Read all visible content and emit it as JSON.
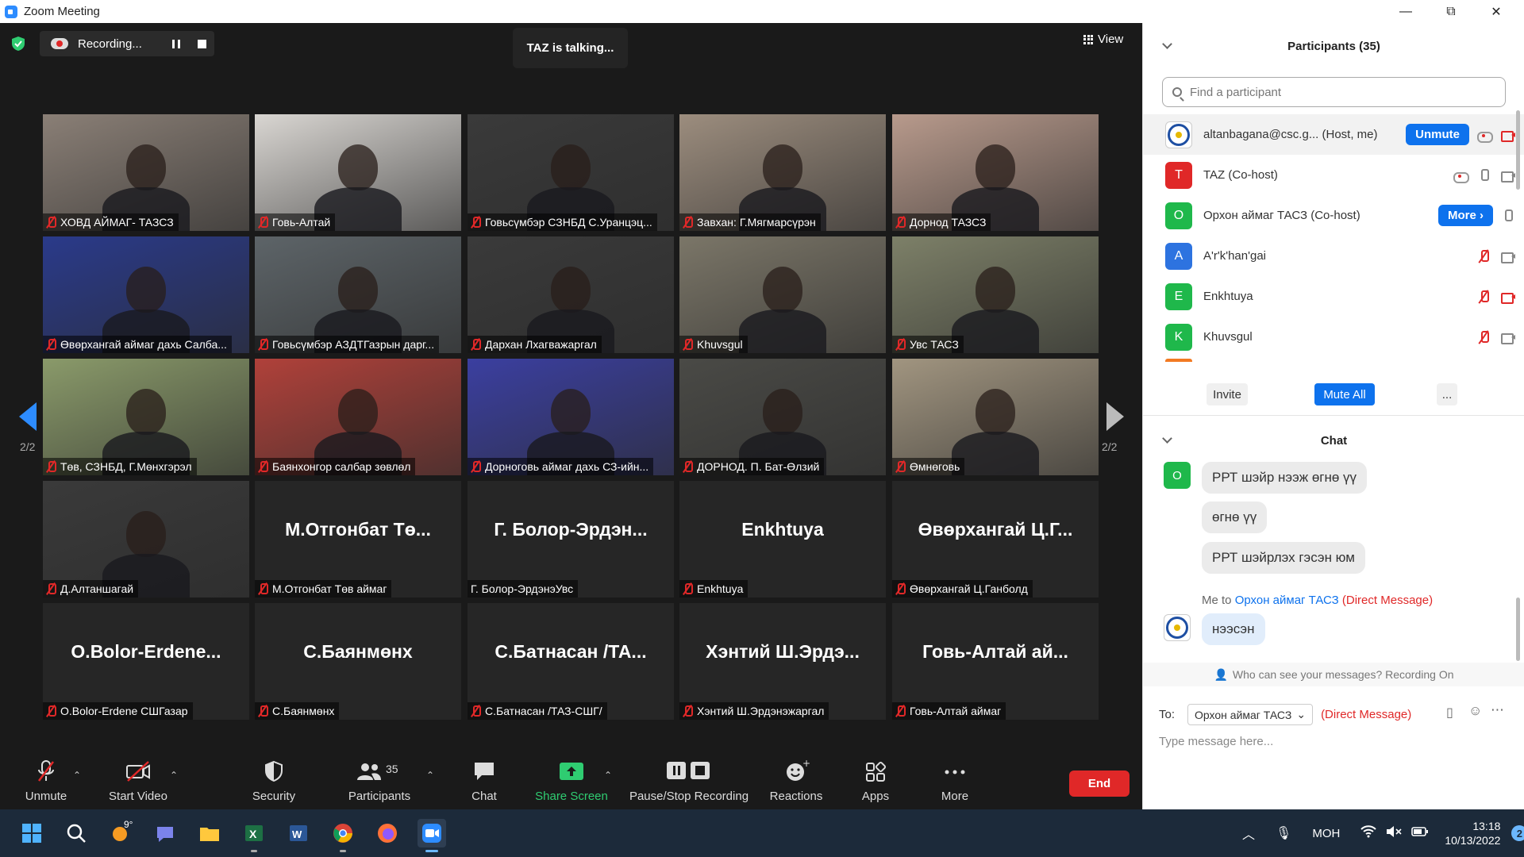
{
  "window": {
    "title": "Zoom Meeting",
    "minimize": "—",
    "maximize": "⧉",
    "close": "✕"
  },
  "top": {
    "recording_label": "Recording...",
    "talking": "TAZ is talking...",
    "view_label": "View",
    "page_left": "2/2",
    "page_right": "2/2"
  },
  "tiles": [
    {
      "name": "ХОВД АЙМАГ- ТАЗСЗ",
      "big": "",
      "bg": "#8a7f76"
    },
    {
      "name": "Говь-Алтай",
      "big": "",
      "bg": "#d9d6d2"
    },
    {
      "name": "Говьсүмбэр СЗНБД С.Уранцэц...",
      "big": "",
      "bg": "#3a3a3a"
    },
    {
      "name": "Завхан: Г.Мягмарсүрэн",
      "big": "",
      "bg": "#9c8d7e"
    },
    {
      "name": "Дорнод ТАЗСЗ",
      "big": "",
      "bg": "#b89a8c"
    },
    {
      "name": "Өвөрхангай аймаг дахь Салба...",
      "big": "",
      "bg": "#2a3a8a"
    },
    {
      "name": "Говьсүмбэр АЗДТГазрын дарг...",
      "big": "",
      "bg": "#5d6468"
    },
    {
      "name": "Дархан Лхагважаргал",
      "big": "",
      "bg": "#3a3a3a"
    },
    {
      "name": "Khuvsgul",
      "big": "",
      "bg": "#7b7668"
    },
    {
      "name": "Увс ТАСЗ",
      "big": "",
      "bg": "#7d8068"
    },
    {
      "name": "Төв, СЗНБД, Г.Мөнхгэрэл",
      "big": "",
      "bg": "#8a9a6a"
    },
    {
      "name": "Баянхонгор салбар зөвлөл",
      "big": "",
      "bg": "#b0413a"
    },
    {
      "name": "Дорноговь аймаг дахь СЗ-ийн...",
      "big": "",
      "bg": "#3b3fa0"
    },
    {
      "name": "ДОРНОД. П. Бат-Өлзий",
      "big": "",
      "bg": "#4a4a46"
    },
    {
      "name": "Өмнөговь",
      "big": "",
      "bg": "#a19580"
    },
    {
      "name": "Д.Алтаншагай",
      "big": "",
      "bg": "#3a3a3a"
    },
    {
      "name": "М.Отгонбат Төв аймаг",
      "big": "М.Отгонбат Тө...",
      "bg": ""
    },
    {
      "name": "Г. Болор-ЭрдэнэУвс",
      "big": "Г. Болор-Эрдэн...",
      "bg": ""
    },
    {
      "name": "Enkhtuya",
      "big": "Enkhtuya",
      "bg": ""
    },
    {
      "name": "Өвөрхангай Ц.Ганболд",
      "big": "Өвөрхангай Ц.Г...",
      "bg": ""
    },
    {
      "name": "О.Bolor-Erdene СШГазар",
      "big": "О.Bolor-Erdene...",
      "bg": ""
    },
    {
      "name": "С.Баянмөнх",
      "big": "С.Баянмөнх",
      "bg": ""
    },
    {
      "name": "С.Батнасан /ТАЗ-СШГ/",
      "big": "С.Батнасан /ТА...",
      "bg": ""
    },
    {
      "name": "Хэнтий Ш.Эрдэнэжаргал",
      "big": "Хэнтий Ш.Эрдэ...",
      "bg": ""
    },
    {
      "name": "Говь-Алтай аймаг",
      "big": "Говь-Алтай ай...",
      "bg": ""
    }
  ],
  "toolbar": {
    "unmute": "Unmute",
    "start_video": "Start Video",
    "security": "Security",
    "participants": "Participants",
    "participants_count": "35",
    "chat": "Chat",
    "share_screen": "Share Screen",
    "pause_stop": "Pause/Stop Recording",
    "reactions": "Reactions",
    "apps": "Apps",
    "more": "More",
    "end": "End"
  },
  "participants_panel": {
    "title": "Participants (35)",
    "search_placeholder": "Find a participant",
    "rows": [
      {
        "initial": "",
        "color": "",
        "name": "altanbagana@csc.g...  (Host, me)",
        "button": "Unmute"
      },
      {
        "initial": "T",
        "color": "#e02828",
        "name": "TAZ (Co-host)",
        "button": ""
      },
      {
        "initial": "O",
        "color": "#1fb84b",
        "name": "Орхон аймаг ТАСЗ (Co-host)",
        "button": "More ›"
      },
      {
        "initial": "A",
        "color": "#2d73e0",
        "name": "A'r'k'han'gai",
        "button": ""
      },
      {
        "initial": "E",
        "color": "#1fb84b",
        "name": "Enkhtuya",
        "button": ""
      },
      {
        "initial": "K",
        "color": "#1fb84b",
        "name": "Khuvsgul",
        "button": ""
      }
    ],
    "invite": "Invite",
    "mute_all": "Mute All",
    "more_dots": "..."
  },
  "chat": {
    "title": "Chat",
    "sender_initial": "O",
    "sender_color": "#1fb84b",
    "messages": [
      "РРТ шэйр нээж өгнө үү",
      "өгнө үү",
      "РРТ шэйрлэх гэсэн юм"
    ],
    "me_to": "Me to ",
    "dm_target": "Орхон аймаг ТАСЗ",
    "dm_suffix": " (Direct Message)",
    "my_message": "нээсэн",
    "notice": "Who can see your messages? Recording On",
    "to_label": "To:",
    "to_value": "Орхон аймаг ТАСЗ",
    "to_dm": "(Direct Message)",
    "input_placeholder": "Type message here..."
  },
  "taskbar": {
    "weather": "9°",
    "lang": "МОН",
    "time": "13:18",
    "date": "10/13/2022",
    "notif_count": "2"
  }
}
